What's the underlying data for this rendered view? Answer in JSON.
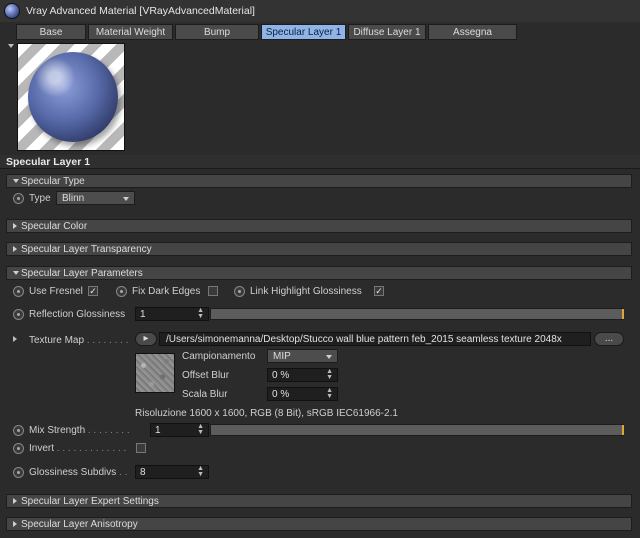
{
  "window": {
    "title": "Vray Advanced Material [VRayAdvancedMaterial]",
    "icon": "material-sphere-icon"
  },
  "tabs": [
    {
      "label": "Base",
      "active": false
    },
    {
      "label": "Material Weight",
      "active": false
    },
    {
      "label": "Bump",
      "active": false
    },
    {
      "label": "Specular Layer 1",
      "active": true
    },
    {
      "label": "Diffuse Layer 1",
      "active": false
    },
    {
      "label": "Assegna",
      "active": false
    }
  ],
  "section": {
    "title": "Specular Layer 1"
  },
  "groups": {
    "specular_type": {
      "label": "Specular Type",
      "expanded": true
    },
    "specular_color": {
      "label": "Specular Color",
      "expanded": false
    },
    "transparency": {
      "label": "Specular Layer Transparency",
      "expanded": false
    },
    "parameters": {
      "label": "Specular Layer Parameters",
      "expanded": true
    },
    "expert": {
      "label": "Specular Layer Expert Settings",
      "expanded": false
    },
    "anisotropy": {
      "label": "Specular Layer Anisotropy",
      "expanded": false
    }
  },
  "type": {
    "label": "Type",
    "value": "Blinn"
  },
  "params": {
    "use_fresnel": {
      "label": "Use Fresnel",
      "checked": true
    },
    "fix_dark_edges": {
      "label": "Fix Dark Edges",
      "checked": false
    },
    "link_highlight": {
      "label": "Link Highlight Glossiness",
      "checked": true
    },
    "reflection_glossiness": {
      "label": "Reflection Glossiness",
      "value": "1",
      "level": 1.0
    },
    "texture_map": {
      "label": "Texture Map",
      "dots": ". . . . . . . .",
      "path": "/Users/simonemanna/Desktop/Stucco wall blue pattern feb_2015 seamless texture 2048x",
      "browse_label": "...",
      "campionamento_label": "Campionamento",
      "campionamento_value": "MIP",
      "offset_blur_label": "Offset Blur",
      "offset_blur_value": "0 %",
      "scala_blur_label": "Scala Blur",
      "scala_blur_value": "0 %",
      "resolution_info": "Risoluzione 1600 x 1600, RGB (8 Bit), sRGB IEC61966-2.1"
    },
    "mix_strength": {
      "label": "Mix Strength",
      "dots": ". . . . . . . .",
      "value": "1",
      "level": 1.0
    },
    "invert": {
      "label": "Invert",
      "dots": ". . . . . . . . . . . . .",
      "checked": false
    },
    "glossiness_subdivs": {
      "label": "Glossiness Subdivs",
      "dots": ". .",
      "value": "8"
    }
  },
  "colors": {
    "active_tab": "#8fb4e8",
    "slider_endmark": "#e3a534",
    "panel_bg": "#2b2b2b"
  },
  "icons": {
    "check": "✓",
    "play": "▸"
  }
}
